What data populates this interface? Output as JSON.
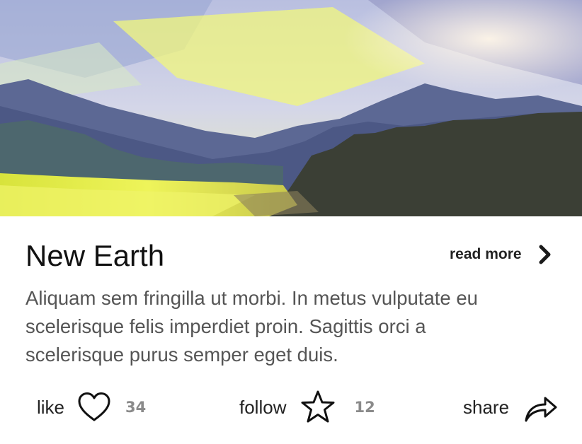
{
  "card": {
    "image": {
      "subject": "painted landscape with mountains, forest and glowing meadow",
      "colors": {
        "sky": "#c4c9e3",
        "glow": "#eef59a",
        "mountains": "#5a6491",
        "forest": "#3d4236",
        "meadow": "#e4ee48"
      }
    },
    "title": "New Earth",
    "read_more": {
      "label": "read more",
      "icon": "chevron-right-icon"
    },
    "description": "Aliquam sem fringilla ut morbi. In metus vulputate eu scelerisque felis imperdiet proin. Sagittis orci a scelerisque purus semper eget duis.",
    "actions": {
      "like": {
        "label": "like",
        "icon": "heart-icon",
        "count": "34"
      },
      "follow": {
        "label": "follow",
        "icon": "star-icon",
        "count": "12"
      },
      "share": {
        "label": "share",
        "icon": "share-arrow-icon"
      }
    }
  }
}
